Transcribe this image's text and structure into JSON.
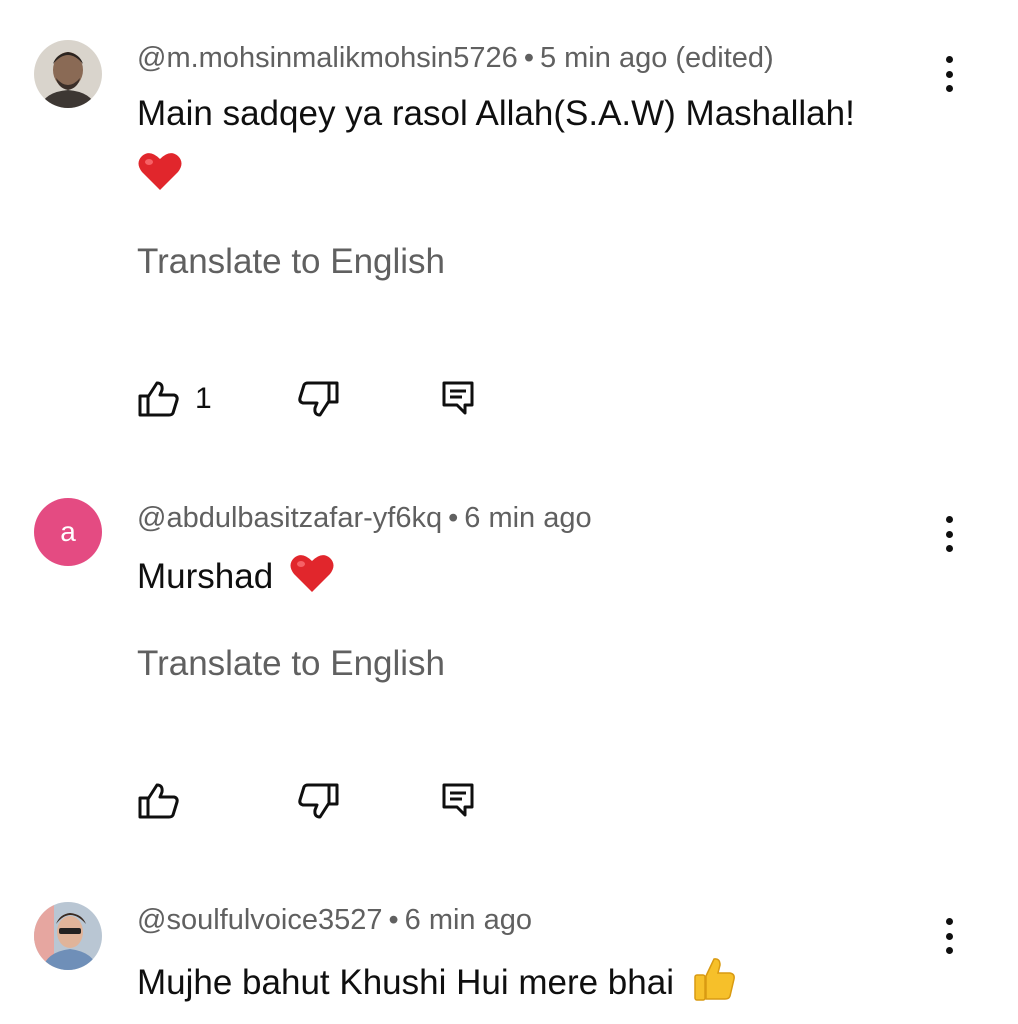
{
  "comments": [
    {
      "handle": "@m.mohsinmalikmohsin5726",
      "time": "5 min ago (edited)",
      "text": "Main sadqey ya rasol Allah(S.A.W) Mashallah!",
      "emoji": "red-heart",
      "translate_label": "Translate to English",
      "like_count": "1",
      "avatar": {
        "type": "photo",
        "description_icon": "user-photo-icon"
      }
    },
    {
      "handle": "@abdulbasitzafar-yf6kq",
      "time": "6 min ago",
      "text": "Murshad",
      "emoji": "red-heart",
      "translate_label": "Translate to English",
      "like_count": "",
      "avatar": {
        "type": "letter",
        "letter": "a",
        "color": "#e44b82"
      }
    },
    {
      "handle": "@soulfulvoice3527",
      "time": "6 min ago",
      "text": "Mujhe bahut Khushi Hui mere bhai",
      "emoji": "thumbs-up",
      "avatar": {
        "type": "photo",
        "description_icon": "user-photo-icon"
      }
    }
  ],
  "icons": {
    "like": "thumbs-up-outline-icon",
    "dislike": "thumbs-down-outline-icon",
    "reply": "comment-reply-icon",
    "menu": "more-vertical-icon"
  },
  "colors": {
    "text_primary": "#0f0f0f",
    "text_secondary": "#606060",
    "heart": "#e1262c",
    "thumb_emoji": "#f6c02a"
  },
  "sep": "•"
}
